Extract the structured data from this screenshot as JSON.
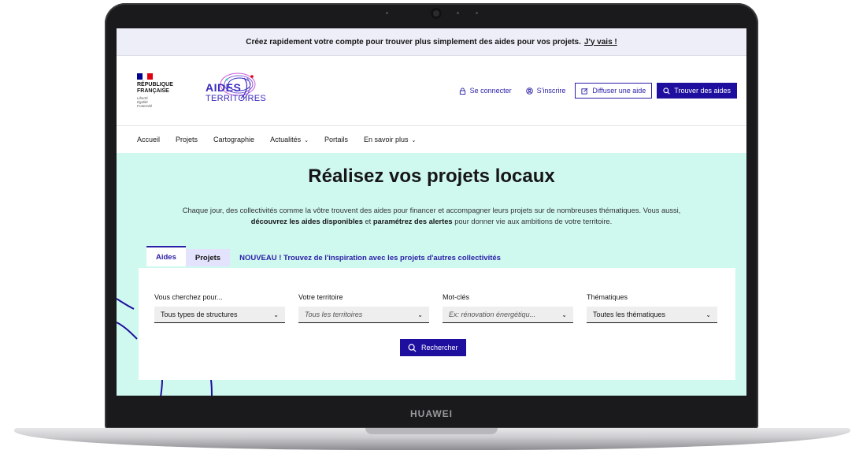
{
  "device": {
    "brand": "HUAWEI"
  },
  "banner": {
    "text": "Créez rapidement votre compte pour trouver plus simplement des aides pour vos projets.",
    "link": "J'y vais !"
  },
  "header": {
    "marianne_lines": [
      "RÉPUBLIQUE",
      "FRANÇAISE"
    ],
    "devise_lines": [
      "Liberté",
      "Égalité",
      "Fraternité"
    ],
    "logo_top": "AIDES",
    "logo_bottom": "TERRITOIRES",
    "login": "Se connecter",
    "signup": "S'inscrire",
    "publish": "Diffuser une aide",
    "find": "Trouver des aides",
    "colors": {
      "primary": "#1e0f9e",
      "flag_blue": "#000091",
      "flag_red": "#e1000f"
    }
  },
  "nav": {
    "items": [
      "Accueil",
      "Projets",
      "Cartographie",
      "Actualités",
      "Portails",
      "En savoir plus"
    ]
  },
  "hero": {
    "title": "Réalisez vos projets locaux",
    "desc_1": "Chaque jour, des collectivités comme la vôtre trouvent des aides pour financer et accompagner leurs projets sur de nombreuses thématiques. Vous aussi,",
    "desc_bold_1": "découvrez les aides disponibles",
    "desc_mid": "et",
    "desc_bold_2": "paramétrez des alertes",
    "desc_end": "pour donner vie aux ambitions de votre territoire.",
    "background": "#cff8ef"
  },
  "tabs": {
    "aides": "Aides",
    "projets": "Projets",
    "nouveau": "NOUVEAU ! Trouvez de l'inspiration avec les projets d'autres collectivités"
  },
  "search": {
    "fields": [
      {
        "label": "Vous cherchez pour...",
        "value": "Tous types de structures"
      },
      {
        "label": "Votre territoire",
        "placeholder": "Tous les territoires"
      },
      {
        "label": "Mot-clés",
        "placeholder": "Ex: rénovation énergétiqu..."
      },
      {
        "label": "Thématiques",
        "value": "Toutes les thématiques"
      }
    ],
    "button": "Rechercher"
  }
}
